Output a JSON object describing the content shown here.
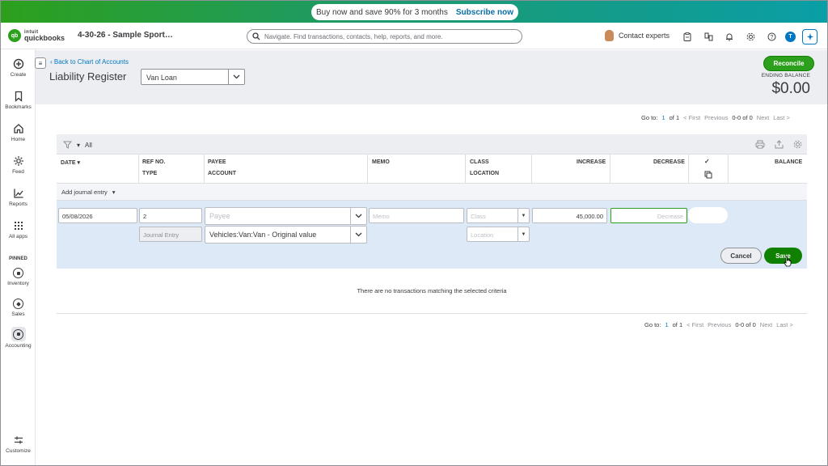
{
  "promo": {
    "text": "Buy now and save 90% for 3 months",
    "link": "Subscribe now"
  },
  "topbar": {
    "logo_line1": "intuit",
    "logo_line2": "quickbooks",
    "company": "4-30-26 - Sample Sport…",
    "search_placeholder": "Navigate. Find transactions, contacts, help, reports, and more.",
    "contact_experts": "Contact experts",
    "user_initial": "T"
  },
  "sidebar": {
    "items": [
      {
        "label": "Create",
        "icon": "plus-circle-icon"
      },
      {
        "label": "Bookmarks",
        "icon": "bookmark-icon"
      },
      {
        "label": "Home",
        "icon": "home-icon"
      },
      {
        "label": "Feed",
        "icon": "feed-icon"
      },
      {
        "label": "Reports",
        "icon": "chart-icon"
      },
      {
        "label": "All apps",
        "icon": "grid-icon"
      }
    ],
    "pinned_label": "PINNED",
    "pinned": [
      {
        "label": "Inventory"
      },
      {
        "label": "Sales"
      },
      {
        "label": "Accounting"
      }
    ],
    "customize": "Customize"
  },
  "header": {
    "back_link": "Back to Chart of Accounts",
    "title": "Liability Register",
    "account": "Van Loan",
    "reconcile": "Reconcile",
    "ending_balance_label": "ENDING BALANCE",
    "ending_balance_value": "$0.00"
  },
  "pager_top": {
    "goto": "Go to:",
    "page": "1",
    "of": "of 1",
    "first": "< First",
    "previous": "Previous",
    "range": "0-0 of 0",
    "next": "Next",
    "last": "Last >"
  },
  "pager_bottom": {
    "goto": "Go to:",
    "page": "1",
    "of": "of 1",
    "first": "< First",
    "previous": "Previous",
    "range": "0-0 of 0",
    "next": "Next",
    "last": "Last >"
  },
  "table": {
    "filter_label": "All",
    "columns": {
      "date": "DATE",
      "ref_no": "REF NO.",
      "type": "TYPE",
      "payee": "PAYEE",
      "account": "ACCOUNT",
      "memo": "MEMO",
      "class": "CLASS",
      "location": "LOCATION",
      "increase": "INCREASE",
      "decrease": "DECREASE",
      "balance": "BALANCE"
    },
    "add_journal_entry": "Add journal entry",
    "edit_row": {
      "date": "05/08/2026",
      "ref_no": "2",
      "payee_placeholder": "Payee",
      "memo_placeholder": "Memo",
      "class_placeholder": "Class",
      "increase": "45,000.00",
      "decrease_placeholder": "Decrease",
      "type": "Journal Entry",
      "account": "Vehicles:Van:Van - Original value",
      "location_placeholder": "Location"
    },
    "cancel": "Cancel",
    "save": "Save",
    "empty_message": "There are no transactions matching the selected criteria"
  }
}
